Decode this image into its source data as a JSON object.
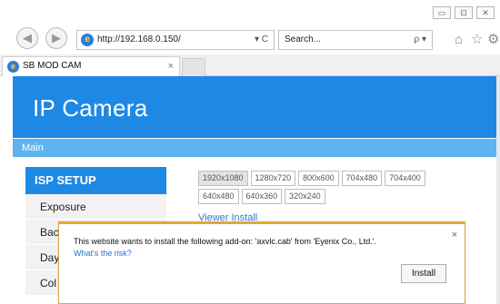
{
  "window": {
    "controls": [
      "▭",
      "⊡",
      "✕"
    ]
  },
  "nav": {
    "back_icon": "◀",
    "forward_icon": "▶",
    "url": "http://192.168.0.150/",
    "url_tools": "▾ C",
    "search_placeholder": "Search...",
    "search_tools": "ρ ▾",
    "home_icon": "⌂",
    "favorites_icon": "☆",
    "settings_icon": "⚙"
  },
  "tab": {
    "title": "SB MOD CAM",
    "close": "×"
  },
  "page": {
    "title": "IP Camera",
    "mainbar": "Main",
    "sidebar": {
      "header": "ISP SETUP",
      "items": [
        "Exposure",
        "Back",
        "Day",
        "Col"
      ]
    },
    "resolutions_row1": [
      "1920x1080",
      "1280x720",
      "800x600",
      "704x480",
      "704x400"
    ],
    "resolutions_row2": [
      "640x480",
      "640x360",
      "320x240"
    ],
    "viewer_link": "Viewer Install"
  },
  "infobar": {
    "message": "This website wants to install the following add-on: 'axvlc.cab' from 'Eyenix Co., Ltd.'.",
    "risk_link": "What's the risk?",
    "close": "×",
    "install_label": "Install"
  },
  "colors": {
    "header_blue": "#1e88e5",
    "mainbar_blue": "#5db4f0",
    "infobar_accent": "#e5a930"
  }
}
